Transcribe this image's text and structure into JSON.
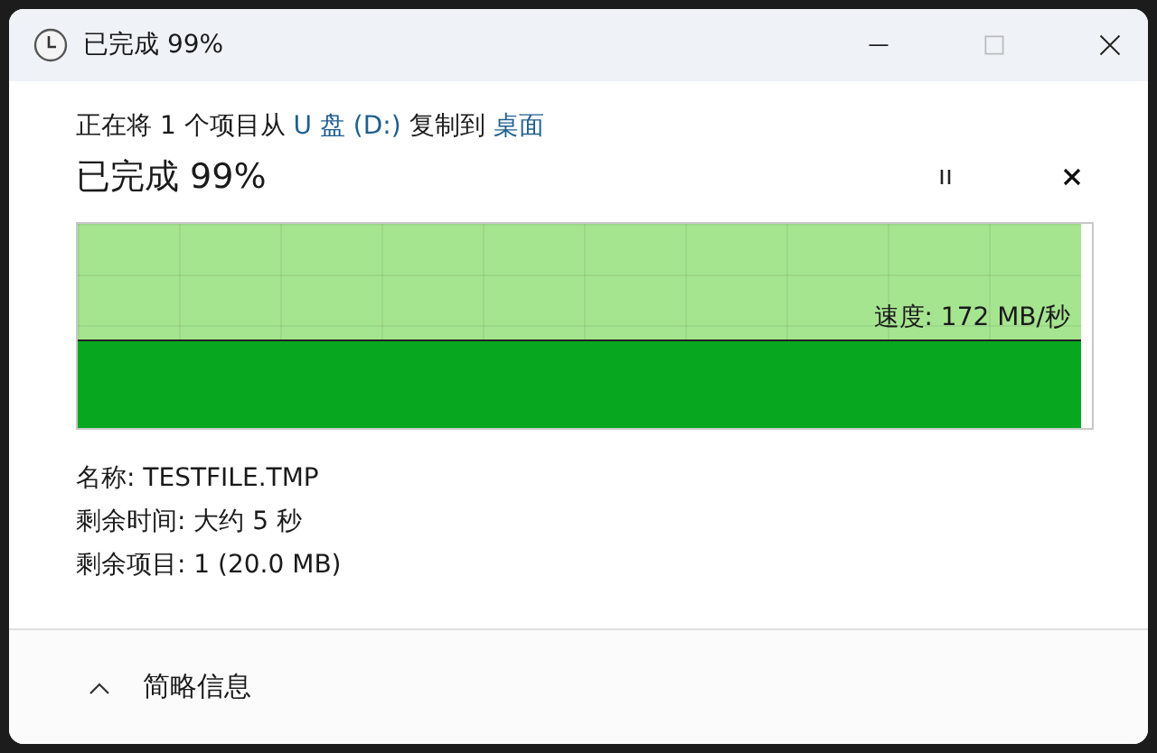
{
  "window": {
    "title": "已完成 99%"
  },
  "copy_line": {
    "prefix": "正在将 1 个项目从 ",
    "source": "U 盘 (D:)",
    "middle": " 复制到 ",
    "destination": "桌面"
  },
  "status": "已完成 99%",
  "progress": {
    "level": 0.99,
    "speed": "速度: 172 MB/秒"
  },
  "details": [
    {
      "label": "名称:",
      "value": "TESTFILE.TMP"
    },
    {
      "label": "剩余时间:",
      "value": "大约 5 秒"
    },
    {
      "label": "剩余项目:",
      "value": "1 (20.0 MB)"
    }
  ],
  "footer": {
    "label": "简略信息",
    "expanded": true
  }
}
